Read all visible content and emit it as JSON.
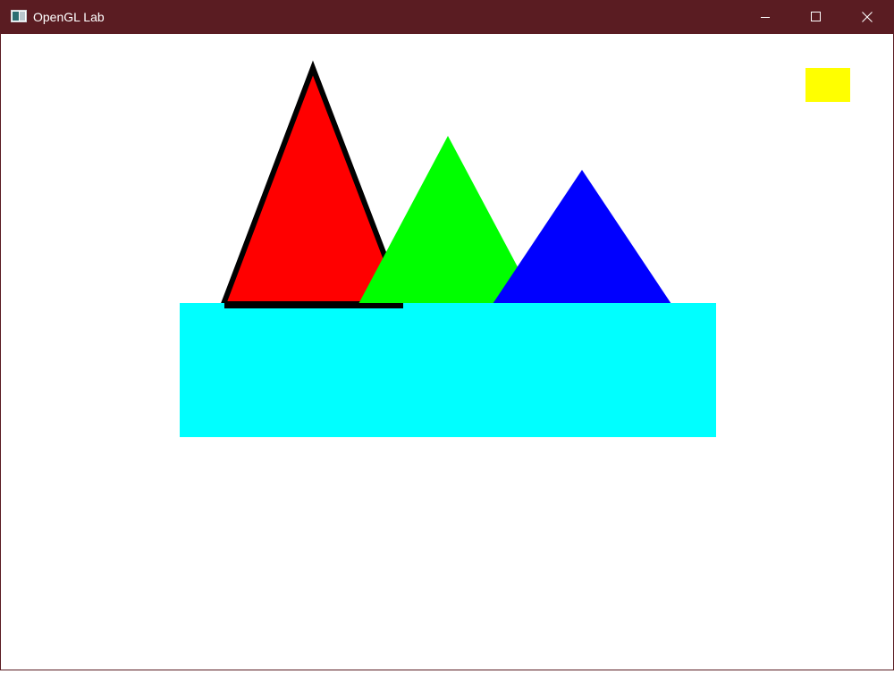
{
  "window": {
    "title": "OpenGL Lab",
    "titlebar_color": "#5a1c22",
    "icons": {
      "app": "app-window-icon",
      "minimize": "minimize-icon",
      "maximize": "maximize-icon",
      "close": "close-icon"
    }
  },
  "scene": {
    "background_color": "#ffffff",
    "shapes": [
      {
        "name": "cyan-rectangle",
        "shape": "rectangle",
        "color": "#00ffff"
      },
      {
        "name": "red-triangle",
        "shape": "triangle",
        "color": "#ff0000",
        "outline_color": "#000000"
      },
      {
        "name": "green-triangle",
        "shape": "triangle",
        "color": "#00ff00"
      },
      {
        "name": "blue-triangle",
        "shape": "triangle",
        "color": "#0000ff"
      },
      {
        "name": "yellow-rectangle",
        "shape": "rectangle",
        "color": "#ffff00"
      }
    ]
  }
}
